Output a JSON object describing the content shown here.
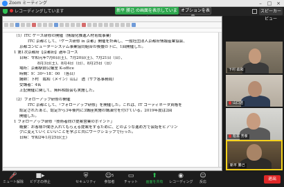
{
  "window": {
    "title": "Zoom ミーティング",
    "minimize": "–",
    "maximize": "□",
    "close": "×"
  },
  "meeting_bar": {
    "recording": "レコーディングしています",
    "share_banner": "新平  勝己 の画面を表示しています",
    "options": "オプションを表示 ⌄",
    "speaker_view": "スピーカービュー"
  },
  "document": {
    "lines": [
      "（1）ITC ケース研修の開催（情報化推進人材育成事業）",
      "ITC 京都として、「ケース研修 in 京都」開催を計画し、一般社団法人京都府情報産業協会、",
      "京都コンピューターシステム事業協同組合の後援の下に、1回開催した。",
      "1 第1次京都府【京都府】過年コース",
      "日時：令和元年7月6日(土)、7月20日(土)、7月21日（日）、",
      "8月3日(土)、8月4日（日）、8月25日（日）",
      "場所：京都駅前公議室 K-office",
      "時間：9：30～18：00　（各日）",
      "講師：下村　紘和（メイン）山口　透（サブ各事務局）",
      "受講者：4名",
      "上記開催に関して、無料相談会も実施した。",
      "（2）フォローアップ研修の開催",
      "ITC 京都として、「フォローアップ研修」を開催した。これは、IT コーディネータ資格を",
      "認定されたあと、認定から3年後内に3講座実施の講演付を付けている。2019年度は2回",
      "開催した。",
      "1 フォローアップ研修「技術者向け提案営業のポイント」",
      "概要：お客様が聞き入れてもらえる提案をするために、どのような進め方で会話をヒアリン",
      "グに変えていくといいことを学ぶと共にワークショップで行った。",
      "日時：令和2年1月25日(土)"
    ]
  },
  "participants": [
    {
      "name": "下村 紘和",
      "muted": false
    },
    {
      "name": "山口透",
      "muted": true
    },
    {
      "name": "松本 芳孝",
      "muted": true
    },
    {
      "name": "新平 勝己",
      "muted": false
    }
  ],
  "toolbar": {
    "mute": "ミュート解除",
    "video": "ビデオの停止",
    "security": "セキュリティ",
    "participants": "参加者",
    "participants_count": "5",
    "chat": "チャット",
    "share": "画面を共有",
    "record": "レコーディング",
    "reactions": "反応",
    "end": "退出"
  },
  "colors": {
    "share_banner": "#2fa84f",
    "end_button": "#e02828",
    "active_speaker": "#f5d21b",
    "zoom_blue": "#2d8cff"
  }
}
